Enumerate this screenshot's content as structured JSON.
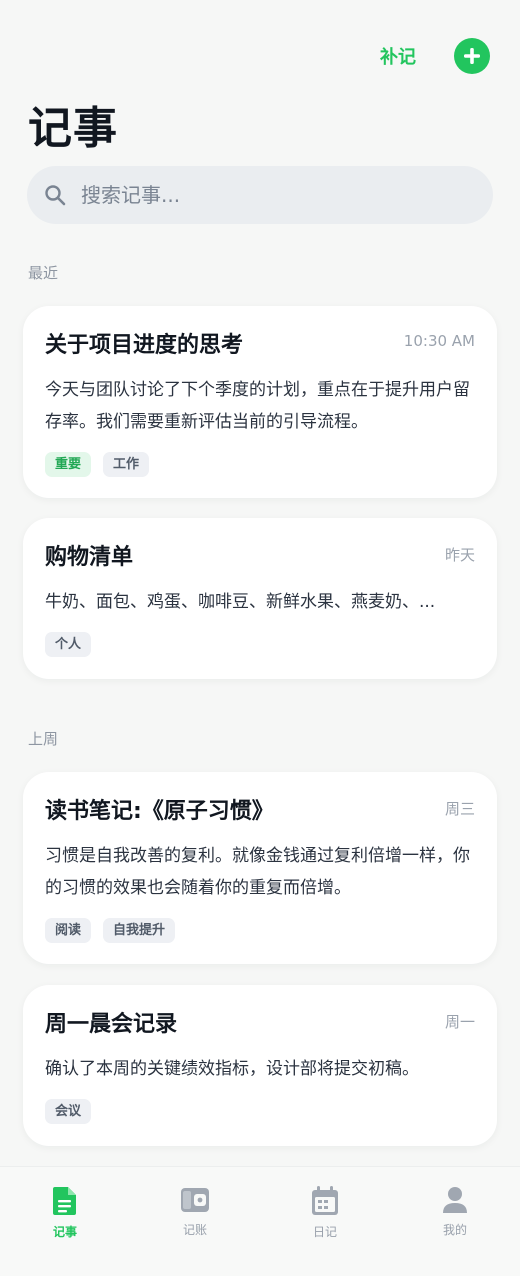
{
  "header": {
    "supplement_label": "补记",
    "add_icon": "plus-circle-icon",
    "title": "记事"
  },
  "search": {
    "placeholder": "搜索记事...",
    "icon": "search-icon"
  },
  "sections": [
    {
      "label": "最近",
      "notes": [
        {
          "title": "关于项目进度的思考",
          "time": "10:30 AM",
          "body": "今天与团队讨论了下个季度的计划，重点在于提升用户留存率。我们需要重新评估当前的引导流程。",
          "tags": [
            "重要",
            "工作"
          ]
        },
        {
          "title": "购物清单",
          "time": "昨天",
          "body": "牛奶、面包、鸡蛋、咖啡豆、新鲜水果、燕麦奶、...",
          "tags": [
            "个人"
          ]
        }
      ]
    },
    {
      "label": "上周",
      "notes": [
        {
          "title": "读书笔记:《原子习惯》",
          "time": "周三",
          "body": "习惯是自我改善的复利。就像金钱通过复利倍增一样，你的习惯的效果也会随着你的重复而倍增。",
          "tags": [
            "阅读",
            "自我提升"
          ]
        },
        {
          "title": "周一晨会记录",
          "time": "周一",
          "body": "确认了本周的关键绩效指标，设计部将提交初稿。",
          "tags": [
            "会议"
          ]
        }
      ]
    }
  ],
  "nav": [
    {
      "label": "记事",
      "icon": "document-icon",
      "active": true
    },
    {
      "label": "记账",
      "icon": "wallet-icon",
      "active": false
    },
    {
      "label": "日记",
      "icon": "calendar-icon",
      "active": false
    },
    {
      "label": "我的",
      "icon": "person-icon",
      "active": false
    }
  ],
  "colors": {
    "accent": "#22c55e",
    "background": "#f6f7f6",
    "tag_green_bg": "#e3f7ea",
    "tag_gray_bg": "#eef0f4"
  }
}
